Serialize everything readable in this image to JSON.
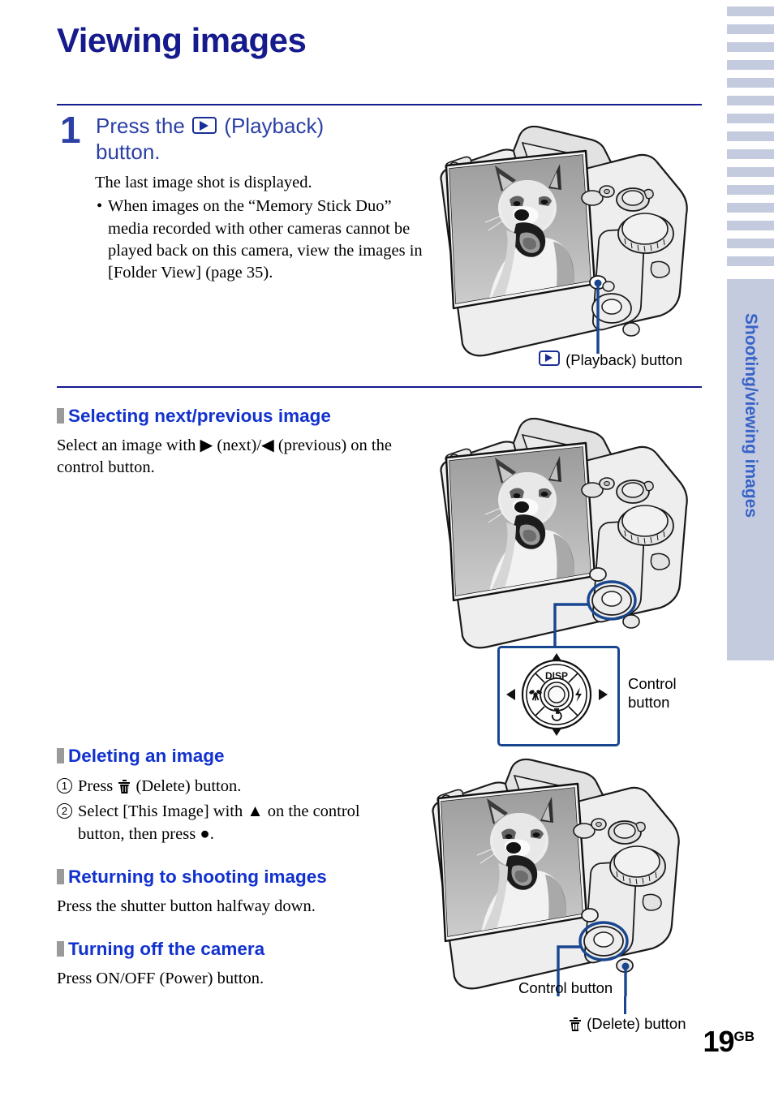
{
  "document": {
    "title": "Viewing images",
    "page_number": "19",
    "page_number_suffix": "GB",
    "side_tab": "Shooting/viewing images",
    "colors": {
      "title_navy": "#151a8c",
      "heading_blue": "#1232cf",
      "step_blue": "#2b3fa5",
      "tab_bg": "#c5cbdf",
      "callout_line": "#18468f",
      "bullet_square_gray": "#9a9a9a"
    },
    "tab_ladder_marks": 15
  },
  "step1": {
    "number": "1",
    "heading_part1": "Press the",
    "heading_icon": "playback-icon",
    "heading_part2": "(Playback)",
    "heading_line2": "button.",
    "body_line": "The last image shot is displayed.",
    "bullet": "When images on the “Memory Stick Duo” media recorded with other cameras cannot be played back on this camera, view the images in [Folder View] (page 35).",
    "figure_caption_icon": "playback-icon",
    "figure_caption": "(Playback) button"
  },
  "section_select": {
    "heading": "Selecting next/previous image",
    "body_part1": "Select an image with",
    "next_arrow": "▶",
    "body_part2": "(next)/",
    "prev_arrow": "◀",
    "body_part3": "(previous) on the control button.",
    "callout_line1": "Control",
    "callout_line2": "button",
    "control_wheel": {
      "top_label": "DISP",
      "left_icon": "macro-flower-icon",
      "right_icon": "flash-bolt-icon",
      "bottom_icon": "self-timer-icon",
      "up_arrow": "▲",
      "down_arrow": "▼",
      "left_arrow": "◀",
      "right_arrow": "▶"
    }
  },
  "section_delete": {
    "heading": "Deleting an image",
    "items": [
      {
        "num": "1",
        "text_before": "Press",
        "icon": "trash-icon",
        "text_after": "(Delete) button."
      },
      {
        "num": "2",
        "text": "Select [This Image] with ▲ on the control button, then press ●."
      }
    ]
  },
  "section_return": {
    "heading": "Returning to shooting images",
    "body": "Press the shutter button halfway down."
  },
  "section_power": {
    "heading": "Turning off the camera",
    "body": "Press ON/OFF (Power) button."
  },
  "figure3": {
    "control_label": "Control button",
    "delete_icon": "trash-icon",
    "delete_label": "(Delete) button"
  }
}
